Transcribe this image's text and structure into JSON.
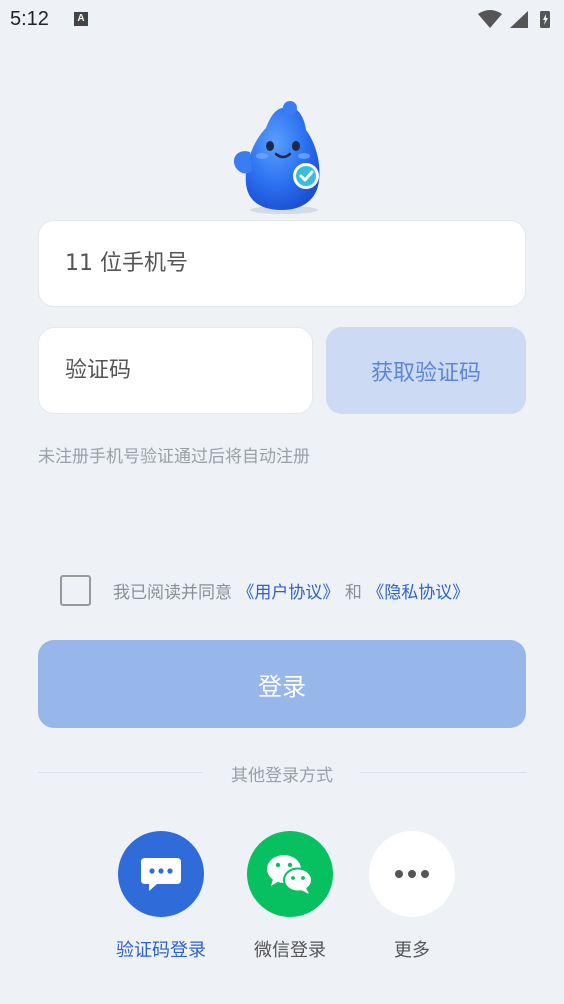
{
  "status": {
    "time": "5:12",
    "notif_letter": "A"
  },
  "form": {
    "phone_placeholder": "11 位手机号",
    "code_placeholder": "验证码",
    "get_code_label": "获取验证码",
    "hint": "未注册手机号验证通过后将自动注册"
  },
  "agreement": {
    "prefix": "我已阅读并同意",
    "user_agreement": "《用户协议》",
    "and": "和",
    "privacy_policy": "《隐私协议》",
    "checked": false
  },
  "login_label": "登录",
  "other_methods": {
    "title": "其他登录方式",
    "options": [
      {
        "label": "验证码登录",
        "icon": "sms-chat-icon",
        "color": "#2F6BD9"
      },
      {
        "label": "微信登录",
        "icon": "wechat-icon",
        "color": "#07C160"
      },
      {
        "label": "更多",
        "icon": "more-dots-icon",
        "color": "#FFFFFF"
      }
    ]
  },
  "colors": {
    "background": "#EEF1F6",
    "primary": "#2E63C6",
    "login_disabled": "#97B6EA"
  }
}
